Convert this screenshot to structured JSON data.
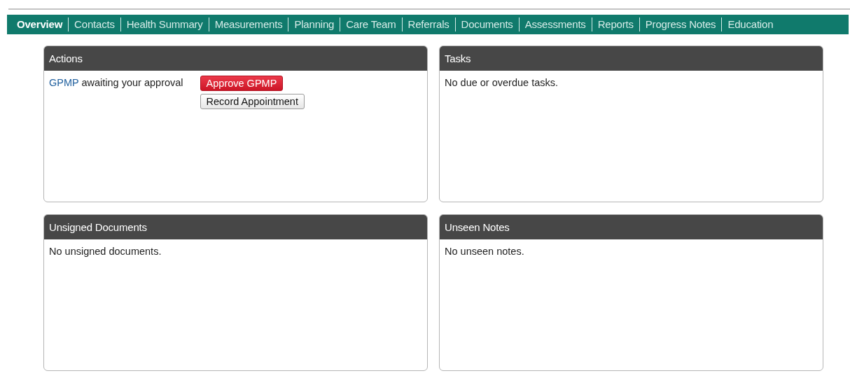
{
  "tabs": [
    {
      "label": "Overview",
      "selected": true
    },
    {
      "label": "Contacts",
      "selected": false
    },
    {
      "label": "Health Summary",
      "selected": false
    },
    {
      "label": "Measurements",
      "selected": false
    },
    {
      "label": "Planning",
      "selected": false
    },
    {
      "label": "Care Team",
      "selected": false
    },
    {
      "label": "Referrals",
      "selected": false
    },
    {
      "label": "Documents",
      "selected": false
    },
    {
      "label": "Assessments",
      "selected": false
    },
    {
      "label": "Reports",
      "selected": false
    },
    {
      "label": "Progress Notes",
      "selected": false
    },
    {
      "label": "Education",
      "selected": false
    }
  ],
  "panels": [
    {
      "title": "Actions",
      "kind": "actions",
      "action": {
        "link": "GPMP",
        "text": "awaiting your approval",
        "buttons": [
          {
            "label": "Approve GPMP",
            "kind": "primary"
          },
          {
            "label": "Record Appointment",
            "kind": "default"
          }
        ]
      }
    },
    {
      "title": "Tasks",
      "kind": "message",
      "message": "No due or overdue tasks."
    },
    {
      "title": "Unsigned Documents",
      "kind": "message",
      "message": "No unsigned documents."
    },
    {
      "title": "Unseen Notes",
      "kind": "message",
      "message": "No unseen notes."
    }
  ]
}
